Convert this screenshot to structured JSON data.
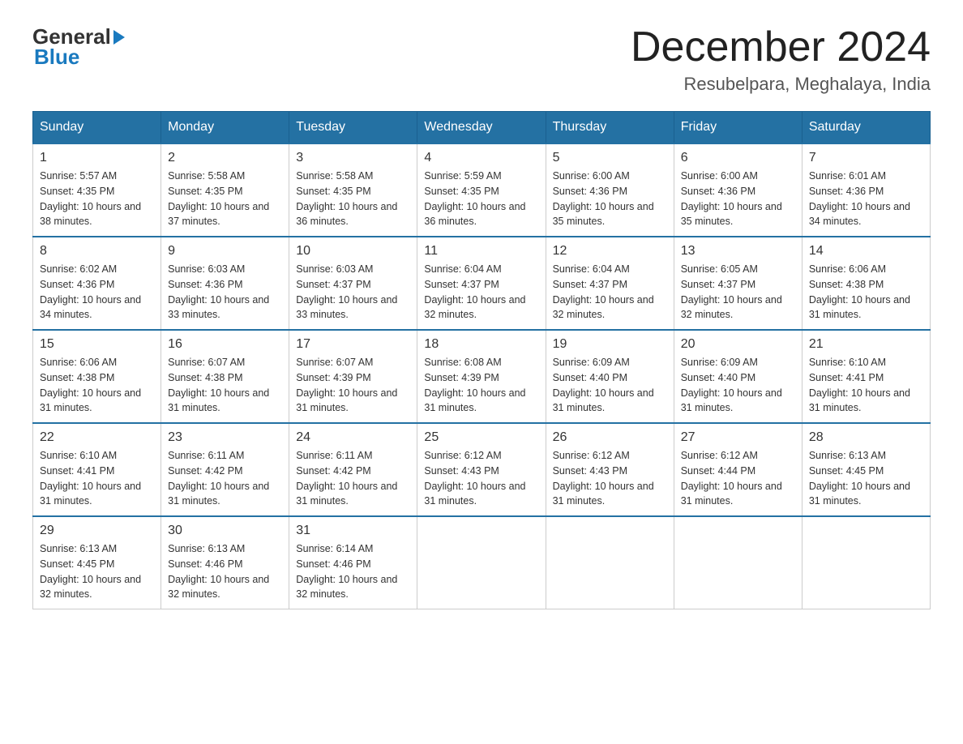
{
  "logo": {
    "general": "General",
    "blue": "Blue"
  },
  "title": "December 2024",
  "location": "Resubelpara, Meghalaya, India",
  "weekdays": [
    "Sunday",
    "Monday",
    "Tuesday",
    "Wednesday",
    "Thursday",
    "Friday",
    "Saturday"
  ],
  "weeks": [
    [
      {
        "day": "1",
        "sunrise": "5:57 AM",
        "sunset": "4:35 PM",
        "daylight": "10 hours and 38 minutes."
      },
      {
        "day": "2",
        "sunrise": "5:58 AM",
        "sunset": "4:35 PM",
        "daylight": "10 hours and 37 minutes."
      },
      {
        "day": "3",
        "sunrise": "5:58 AM",
        "sunset": "4:35 PM",
        "daylight": "10 hours and 36 minutes."
      },
      {
        "day": "4",
        "sunrise": "5:59 AM",
        "sunset": "4:35 PM",
        "daylight": "10 hours and 36 minutes."
      },
      {
        "day": "5",
        "sunrise": "6:00 AM",
        "sunset": "4:36 PM",
        "daylight": "10 hours and 35 minutes."
      },
      {
        "day": "6",
        "sunrise": "6:00 AM",
        "sunset": "4:36 PM",
        "daylight": "10 hours and 35 minutes."
      },
      {
        "day": "7",
        "sunrise": "6:01 AM",
        "sunset": "4:36 PM",
        "daylight": "10 hours and 34 minutes."
      }
    ],
    [
      {
        "day": "8",
        "sunrise": "6:02 AM",
        "sunset": "4:36 PM",
        "daylight": "10 hours and 34 minutes."
      },
      {
        "day": "9",
        "sunrise": "6:03 AM",
        "sunset": "4:36 PM",
        "daylight": "10 hours and 33 minutes."
      },
      {
        "day": "10",
        "sunrise": "6:03 AM",
        "sunset": "4:37 PM",
        "daylight": "10 hours and 33 minutes."
      },
      {
        "day": "11",
        "sunrise": "6:04 AM",
        "sunset": "4:37 PM",
        "daylight": "10 hours and 32 minutes."
      },
      {
        "day": "12",
        "sunrise": "6:04 AM",
        "sunset": "4:37 PM",
        "daylight": "10 hours and 32 minutes."
      },
      {
        "day": "13",
        "sunrise": "6:05 AM",
        "sunset": "4:37 PM",
        "daylight": "10 hours and 32 minutes."
      },
      {
        "day": "14",
        "sunrise": "6:06 AM",
        "sunset": "4:38 PM",
        "daylight": "10 hours and 31 minutes."
      }
    ],
    [
      {
        "day": "15",
        "sunrise": "6:06 AM",
        "sunset": "4:38 PM",
        "daylight": "10 hours and 31 minutes."
      },
      {
        "day": "16",
        "sunrise": "6:07 AM",
        "sunset": "4:38 PM",
        "daylight": "10 hours and 31 minutes."
      },
      {
        "day": "17",
        "sunrise": "6:07 AM",
        "sunset": "4:39 PM",
        "daylight": "10 hours and 31 minutes."
      },
      {
        "day": "18",
        "sunrise": "6:08 AM",
        "sunset": "4:39 PM",
        "daylight": "10 hours and 31 minutes."
      },
      {
        "day": "19",
        "sunrise": "6:09 AM",
        "sunset": "4:40 PM",
        "daylight": "10 hours and 31 minutes."
      },
      {
        "day": "20",
        "sunrise": "6:09 AM",
        "sunset": "4:40 PM",
        "daylight": "10 hours and 31 minutes."
      },
      {
        "day": "21",
        "sunrise": "6:10 AM",
        "sunset": "4:41 PM",
        "daylight": "10 hours and 31 minutes."
      }
    ],
    [
      {
        "day": "22",
        "sunrise": "6:10 AM",
        "sunset": "4:41 PM",
        "daylight": "10 hours and 31 minutes."
      },
      {
        "day": "23",
        "sunrise": "6:11 AM",
        "sunset": "4:42 PM",
        "daylight": "10 hours and 31 minutes."
      },
      {
        "day": "24",
        "sunrise": "6:11 AM",
        "sunset": "4:42 PM",
        "daylight": "10 hours and 31 minutes."
      },
      {
        "day": "25",
        "sunrise": "6:12 AM",
        "sunset": "4:43 PM",
        "daylight": "10 hours and 31 minutes."
      },
      {
        "day": "26",
        "sunrise": "6:12 AM",
        "sunset": "4:43 PM",
        "daylight": "10 hours and 31 minutes."
      },
      {
        "day": "27",
        "sunrise": "6:12 AM",
        "sunset": "4:44 PM",
        "daylight": "10 hours and 31 minutes."
      },
      {
        "day": "28",
        "sunrise": "6:13 AM",
        "sunset": "4:45 PM",
        "daylight": "10 hours and 31 minutes."
      }
    ],
    [
      {
        "day": "29",
        "sunrise": "6:13 AM",
        "sunset": "4:45 PM",
        "daylight": "10 hours and 32 minutes."
      },
      {
        "day": "30",
        "sunrise": "6:13 AM",
        "sunset": "4:46 PM",
        "daylight": "10 hours and 32 minutes."
      },
      {
        "day": "31",
        "sunrise": "6:14 AM",
        "sunset": "4:46 PM",
        "daylight": "10 hours and 32 minutes."
      },
      null,
      null,
      null,
      null
    ]
  ]
}
